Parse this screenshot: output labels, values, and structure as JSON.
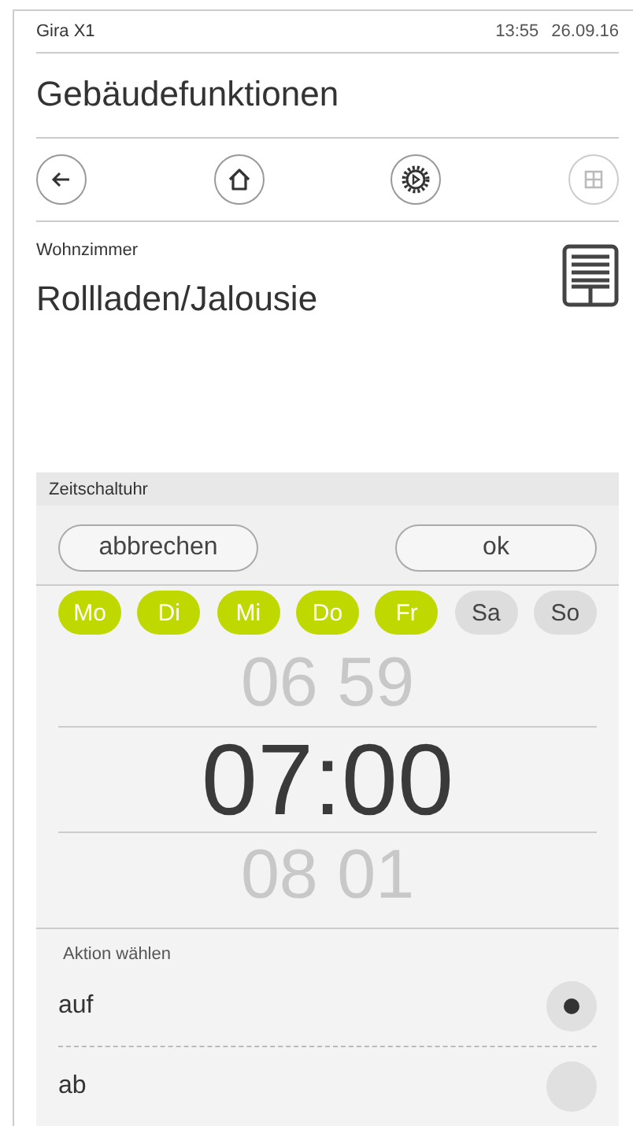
{
  "status_bar": {
    "device": "Gira X1",
    "time": "13:55",
    "date": "26.09.16"
  },
  "title": "Gebäudefunktionen",
  "nav": [
    {
      "kind": "back",
      "disabled": false
    },
    {
      "kind": "home",
      "disabled": false
    },
    {
      "kind": "gear",
      "disabled": false
    },
    {
      "kind": "grid",
      "disabled": true
    }
  ],
  "room": "Wohnzimmer",
  "function": "Rollladen/Jalousie",
  "timer_panel": {
    "header": "Zeitschaltuhr",
    "buttons": [
      "abbrechen",
      "ok"
    ],
    "days": [
      {
        "label": "Mo",
        "selected": true
      },
      {
        "label": "Di",
        "selected": true
      },
      {
        "label": "Mi",
        "selected": true
      },
      {
        "label": "Do",
        "selected": true
      },
      {
        "label": "Fr",
        "selected": true
      },
      {
        "label": "Sa",
        "selected": false
      },
      {
        "label": "So",
        "selected": false
      }
    ],
    "time_picker": {
      "above": "06 59",
      "value": "07:00",
      "below": "08 01"
    },
    "action_label": "Aktion wählen",
    "actions": [
      {
        "label": "auf",
        "selected": true
      },
      {
        "label": "ab",
        "selected": false
      }
    ]
  }
}
